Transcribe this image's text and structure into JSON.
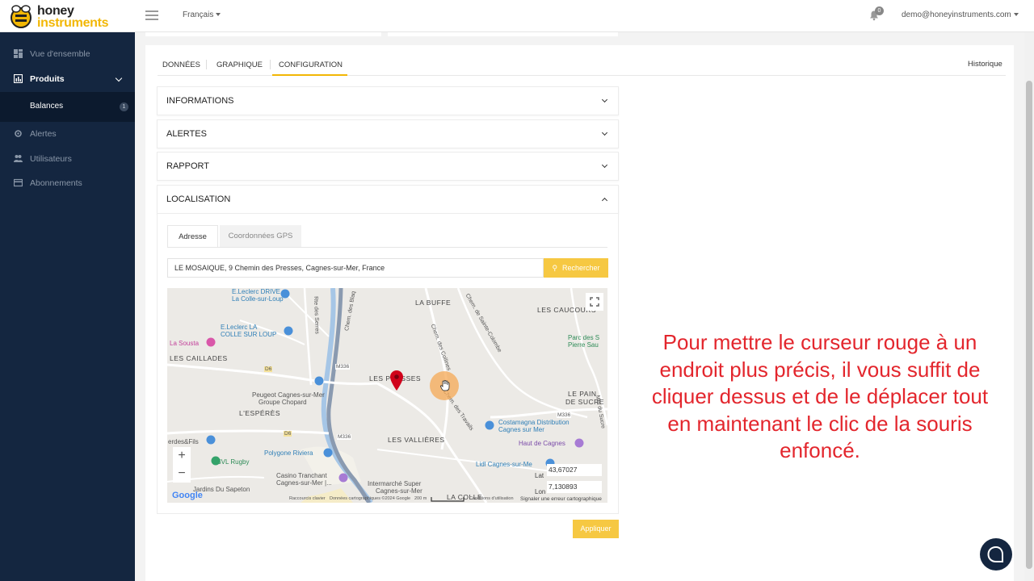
{
  "brand": {
    "line1": "honey",
    "line2": "instruments"
  },
  "topbar": {
    "language": "Français",
    "notifications_count": "0",
    "user_email": "demo@honeyinstruments.com"
  },
  "sidebar": {
    "items": [
      {
        "label": "Vue d'ensemble",
        "icon": "dashboard-icon"
      },
      {
        "label": "Produits",
        "icon": "chart-icon"
      },
      {
        "label": "Alertes",
        "icon": "gear-icon"
      },
      {
        "label": "Utilisateurs",
        "icon": "users-icon"
      },
      {
        "label": "Abonnements",
        "icon": "card-icon"
      }
    ],
    "sub_item": {
      "label": "Balances",
      "badge": "1"
    }
  },
  "tabs": [
    "DONNÉES",
    "GRAPHIQUE",
    "CONFIGURATION"
  ],
  "active_tab": "CONFIGURATION",
  "historique": "Historique",
  "accordions": [
    "INFORMATIONS",
    "ALERTES",
    "RAPPORT",
    "LOCALISATION"
  ],
  "location": {
    "subtabs": [
      "Adresse",
      "Coordonnées GPS"
    ],
    "address_value": "LE MOSAIQUE, 9 Chemin des Presses, Cagnes-sur-Mer, France",
    "search_button": "Rechercher",
    "apply_button": "Appliquer"
  },
  "map": {
    "places": {
      "la_buffe": "LA BUFFE",
      "les_caucours": "LES CAUCOURS",
      "les_presses": "LES PRESSES",
      "les_caillades": "LES CAILLADES",
      "l_esperes": "L'ESPÉRÈS",
      "les_vallieres": "LES VALLIÈRES",
      "le_pain_de_sucre_1": "LE PAIN",
      "le_pain_de_sucre_2": "DE SUCRE",
      "la_colle": "LA COLLE",
      "rte_des_serres": "Rte des Serres",
      "chem_des_collines": "Chem. des Collines",
      "chem_ste_colombe": "Chem. de Sainte-Colombe",
      "chem_travails": "Chem. des Travails",
      "chem_blaq": "Chem. des Blaq",
      "mont_sucre": "Mnt du Sucre"
    },
    "pois": {
      "leclerc_drive_1": "E.Leclerc DRIVE",
      "leclerc_drive_2": "La Colle-sur-Loup",
      "leclerc_la_1": "E.Leclerc LA",
      "leclerc_la_2": "COLLE SUR LOUP",
      "la_sousta": "La Sousta",
      "peugeot_1": "Peugeot Cagnes-sur-Mer",
      "peugeot_2": "Groupe Chopard",
      "costamagna_1": "Costamagna Distribution",
      "costamagna_2": "Cagnes sur Mer",
      "haut_de_cagnes": "Haut de Cagnes",
      "parc_1": "Parc des S",
      "parc_2": "Pierre Sau",
      "polygone": "Polygone Riviera",
      "lidl": "Lidl Cagnes-sur-Me",
      "esvl": "ESVL Rugby",
      "casino_1": "Casino Tranchant",
      "casino_2": "Cagnes-sur-Mer |...",
      "intermarche_1": "Intermarché Super",
      "intermarche_2": "Cagnes-sur-Mer",
      "jardins": "Jardins Du Sapeton",
      "erdes": "erdes&Fils"
    },
    "roads": {
      "m336a": "M336",
      "m336b": "M336",
      "m336c": "M336",
      "d6a": "D6",
      "d6b": "D6"
    },
    "zoom_in": "+",
    "zoom_out": "−",
    "lat_label": "Lat",
    "lon_label": "Lon",
    "lat_value": "43,67027",
    "lon_value": "7,130893",
    "google": "Google",
    "shortcuts": "Raccourcis clavier",
    "data_credit": "Données cartographiques ©2024 Google",
    "scale": "200 m",
    "terms": "Conditions d'utilisation",
    "report": "Signaler une erreur cartographique"
  },
  "annotation": "Pour mettre le curseur rouge à un endroit plus précis, il vous suffit de cliquer dessus et de le déplacer tout en maintenant le clic de la souris enfoncé.",
  "colors": {
    "accent": "#f6c842",
    "sidebar": "#142640",
    "annotation": "#e3262d",
    "marker": "#d0021b"
  }
}
